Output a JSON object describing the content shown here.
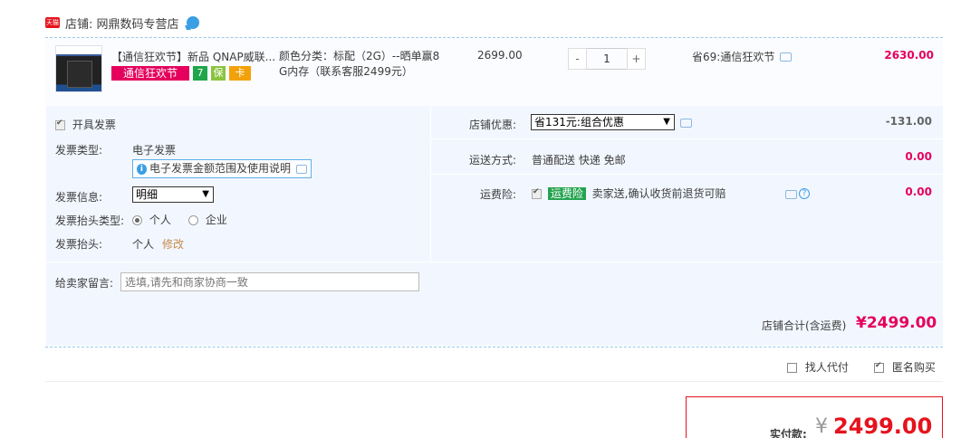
{
  "shop": {
    "badge": "天猫",
    "name": "店铺: 网鼎数码专营店"
  },
  "item": {
    "title": "【通信狂欢节】新品 QNAP威联...",
    "promo_tag": "通信狂欢节",
    "service_icons": [
      {
        "label": "7",
        "color": "#1fa54a"
      },
      {
        "label": "保",
        "color": "#8ac43f"
      },
      {
        "label": "卡",
        "color": "#f3a10a"
      }
    ],
    "sku_line1": "颜色分类：标配（2G）--晒单赢8",
    "sku_line2": "G内存（联系客服2499元）",
    "unit_price": "2699.00",
    "quantity": "1",
    "qty_minus": "-",
    "qty_plus": "+",
    "saving": "省69:通信狂欢节",
    "subtotal": "2630.00"
  },
  "invoice": {
    "issue_label": "开具发票",
    "type_label": "发票类型:",
    "type_value": "电子发票",
    "e_note": "电子发票金额范围及使用说明",
    "info_label": "发票信息:",
    "info_value": "明细",
    "title_type_label": "发票抬头类型:",
    "title_type_personal": "个人",
    "title_type_company": "企业",
    "title_label": "发票抬头:",
    "title_value": "个人",
    "title_edit": "修改"
  },
  "delivery": {
    "discount_label": "店铺优惠:",
    "discount_value": "省131元:组合优惠",
    "discount_amount": "-131.00",
    "shipping_label": "运送方式:",
    "shipping_value": "普通配送 快递 免邮",
    "shipping_amount": "0.00",
    "insurance_label": "运费险:",
    "insurance_tag": "运费险",
    "insurance_text": "卖家送,确认收货前退货可赔",
    "insurance_amount": "0.00"
  },
  "note": {
    "label": "给卖家留言:",
    "placeholder": "选填,请先和商家协商一致"
  },
  "total": {
    "label": "店铺合计(含运费)",
    "value": "¥2499.00"
  },
  "options": {
    "proxy_pay": "找人代付",
    "anonymous": "匿名购买"
  },
  "pay": {
    "label": "实付款:",
    "currency": "¥",
    "value": "2499.00"
  }
}
